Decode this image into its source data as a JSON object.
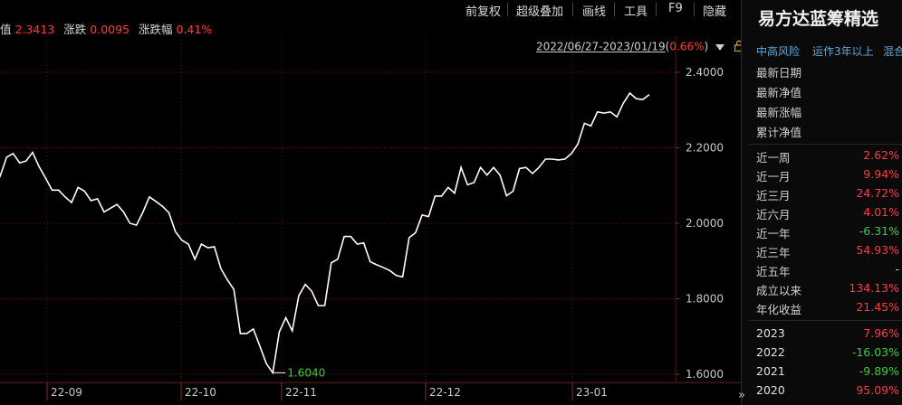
{
  "toolbar": {
    "items": [
      "前复权",
      "超级叠加",
      "画线",
      "工具",
      "F9",
      "隐藏"
    ]
  },
  "infobar": {
    "nav_label": "值",
    "nav_value": "2.3413",
    "change_label": "涨跌",
    "change_value": "0.0095",
    "pct_label": "涨跌幅",
    "pct_value": "0.41%"
  },
  "range": {
    "dates": "2022/06/27-2023/01/19",
    "open_paren": "(",
    "pct": "0.66%",
    "close_paren": ")"
  },
  "chart_data": {
    "type": "line",
    "ylim": [
      1.56,
      2.44
    ],
    "yticks": [
      "2.4000",
      "2.2000",
      "2.0000",
      "1.8000",
      "1.6000"
    ],
    "xticks": [
      "22-09",
      "22-10",
      "22-11",
      "22-12",
      "23-01"
    ],
    "min_label": "1.6040",
    "colors": {
      "line": "#ffffff",
      "grid": "#5a1414"
    },
    "series": [
      {
        "values": [
          2.15,
          2.125,
          2.175,
          2.185,
          2.16,
          2.165,
          2.188,
          2.15,
          2.12,
          2.088,
          2.088,
          2.07,
          2.055,
          2.095,
          2.085,
          2.06,
          2.065,
          2.03,
          2.04,
          2.05,
          2.03,
          2.0,
          1.995,
          2.03,
          2.07,
          2.058,
          2.045,
          2.028,
          1.978,
          1.955,
          1.945,
          1.905,
          1.945,
          1.935,
          1.938,
          1.88,
          1.85,
          1.825,
          1.708,
          1.708,
          1.72,
          1.675,
          1.628,
          1.604,
          1.712,
          1.75,
          1.715,
          1.808,
          1.838,
          1.82,
          1.782,
          1.782,
          1.895,
          1.905,
          1.965,
          1.965,
          1.945,
          1.948,
          1.898,
          1.89,
          1.883,
          1.875,
          1.862,
          1.858,
          1.962,
          1.975,
          2.022,
          2.018,
          2.072,
          2.072,
          2.095,
          2.08,
          2.148,
          2.102,
          2.108,
          2.148,
          2.128,
          2.148,
          2.128,
          2.073,
          2.085,
          2.145,
          2.148,
          2.132,
          2.148,
          2.17,
          2.17,
          2.168,
          2.17,
          2.185,
          2.21,
          2.265,
          2.258,
          2.295,
          2.292,
          2.295,
          2.282,
          2.318,
          2.345,
          2.33,
          2.328,
          2.341
        ]
      }
    ]
  },
  "panel": {
    "title": "易方达蓝筹精选",
    "tags": [
      "中高风险",
      "运作3年以上",
      "混合"
    ],
    "info_rows": [
      "最新日期",
      "最新净值",
      "最新涨幅",
      "累计净值"
    ],
    "perf_rows": [
      {
        "label": "近一周",
        "value": "2.62%",
        "color": "#ff3a3a"
      },
      {
        "label": "近一月",
        "value": "9.94%",
        "color": "#ff3a3a"
      },
      {
        "label": "近三月",
        "value": "24.72%",
        "color": "#ff3a3a"
      },
      {
        "label": "近六月",
        "value": "4.01%",
        "color": "#ff3a3a"
      },
      {
        "label": "近一年",
        "value": "-6.31%",
        "color": "#35d035"
      },
      {
        "label": "近三年",
        "value": "54.93%",
        "color": "#ff3a3a"
      },
      {
        "label": "近五年",
        "value": "-",
        "color": "#d8d8d8"
      },
      {
        "label": "成立以来",
        "value": "134.13%",
        "color": "#ff3a3a"
      },
      {
        "label": "年化收益",
        "value": "21.45%",
        "color": "#ff3a3a"
      }
    ],
    "year_rows": [
      {
        "label": "2023",
        "value": "7.96%",
        "color": "#ff3a3a"
      },
      {
        "label": "2022",
        "value": "-16.03%",
        "color": "#35d035"
      },
      {
        "label": "2021",
        "value": "-9.89%",
        "color": "#35d035"
      },
      {
        "label": "2020",
        "value": "95.09%",
        "color": "#ff3a3a"
      }
    ],
    "expand_glyph": "»"
  }
}
